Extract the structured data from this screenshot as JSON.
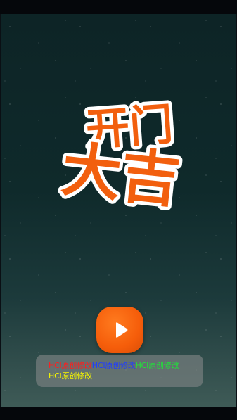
{
  "status_bar": {},
  "logo": {
    "text_line1": "开门",
    "text_line2": "大吉",
    "fill_color": "#f25f0e",
    "outline_color": "#ffffff"
  },
  "play_button": {
    "icon": "play-icon",
    "color": "#f55d0a"
  },
  "toast": {
    "segments": [
      {
        "text": "HCI原创修改",
        "color": "#ff1e1e"
      },
      {
        "text": "HCI原创修改",
        "color": "#1f3dff"
      },
      {
        "text": "HCI原创修改",
        "color": "#22e03a"
      },
      {
        "text": "HCI原创修改",
        "color": "#f6f600"
      }
    ]
  },
  "theme": {
    "background_top": "#0d2426",
    "background_bottom": "#3f5b57"
  }
}
